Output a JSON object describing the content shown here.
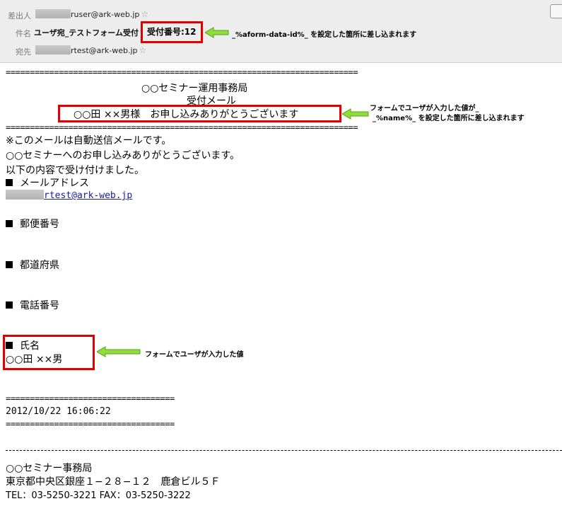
{
  "header": {
    "from_label": "差出人",
    "from_value": "ruser@ark-web.jp",
    "subject_label": "件名",
    "subject_value": "ユーザ宛_テストフォーム受付",
    "receipt_number": "受付番号:12",
    "to_label": "宛先",
    "to_value": "rtest@ark-web.jp"
  },
  "annotations": {
    "receipt_note": "_%aform-data-id%_ を設定した箇所に差し込まれます",
    "name_note_line1": "フォームでユーザが入力した値が_",
    "name_note_line2": "_%name%_ を設定した箇所に差し込まれます",
    "field_note": "フォームでユーザが入力した値"
  },
  "mail": {
    "rule_top": "=========================================================================",
    "org_title": "○○セミナー運用事務局",
    "mail_title": "受付メール",
    "greeting": "○○田 ××男様　お申し込みありがとうございます",
    "rule_mid": "=========================================================================",
    "intro_1": "※このメールは自動送信メールです。",
    "intro_2": "○○セミナーへのお申し込みありがとうございます。",
    "intro_3": "以下の内容で受け付けました。",
    "email_heading": "メールアドレス",
    "email_value": "rtest@ark-web.jp",
    "zip_heading": "郵便番号",
    "pref_heading": "都道府県",
    "tel_heading": "電話番号",
    "name_heading": "氏名",
    "name_value": "○○田 ××男",
    "rule_short": "===================================",
    "timestamp": "2012/10/22 16:06:22",
    "footer_org": "○○セミナー事務局",
    "footer_address": "東京都中央区銀座１−２８−１２　鹿倉ビル５Ｆ",
    "footer_tel": "TEL：03-5250-3221  FAX：03-5250-3222"
  },
  "colors": {
    "highlight_border": "#e00000",
    "arrow": "#7ed321",
    "link": "#1a1aa6"
  }
}
